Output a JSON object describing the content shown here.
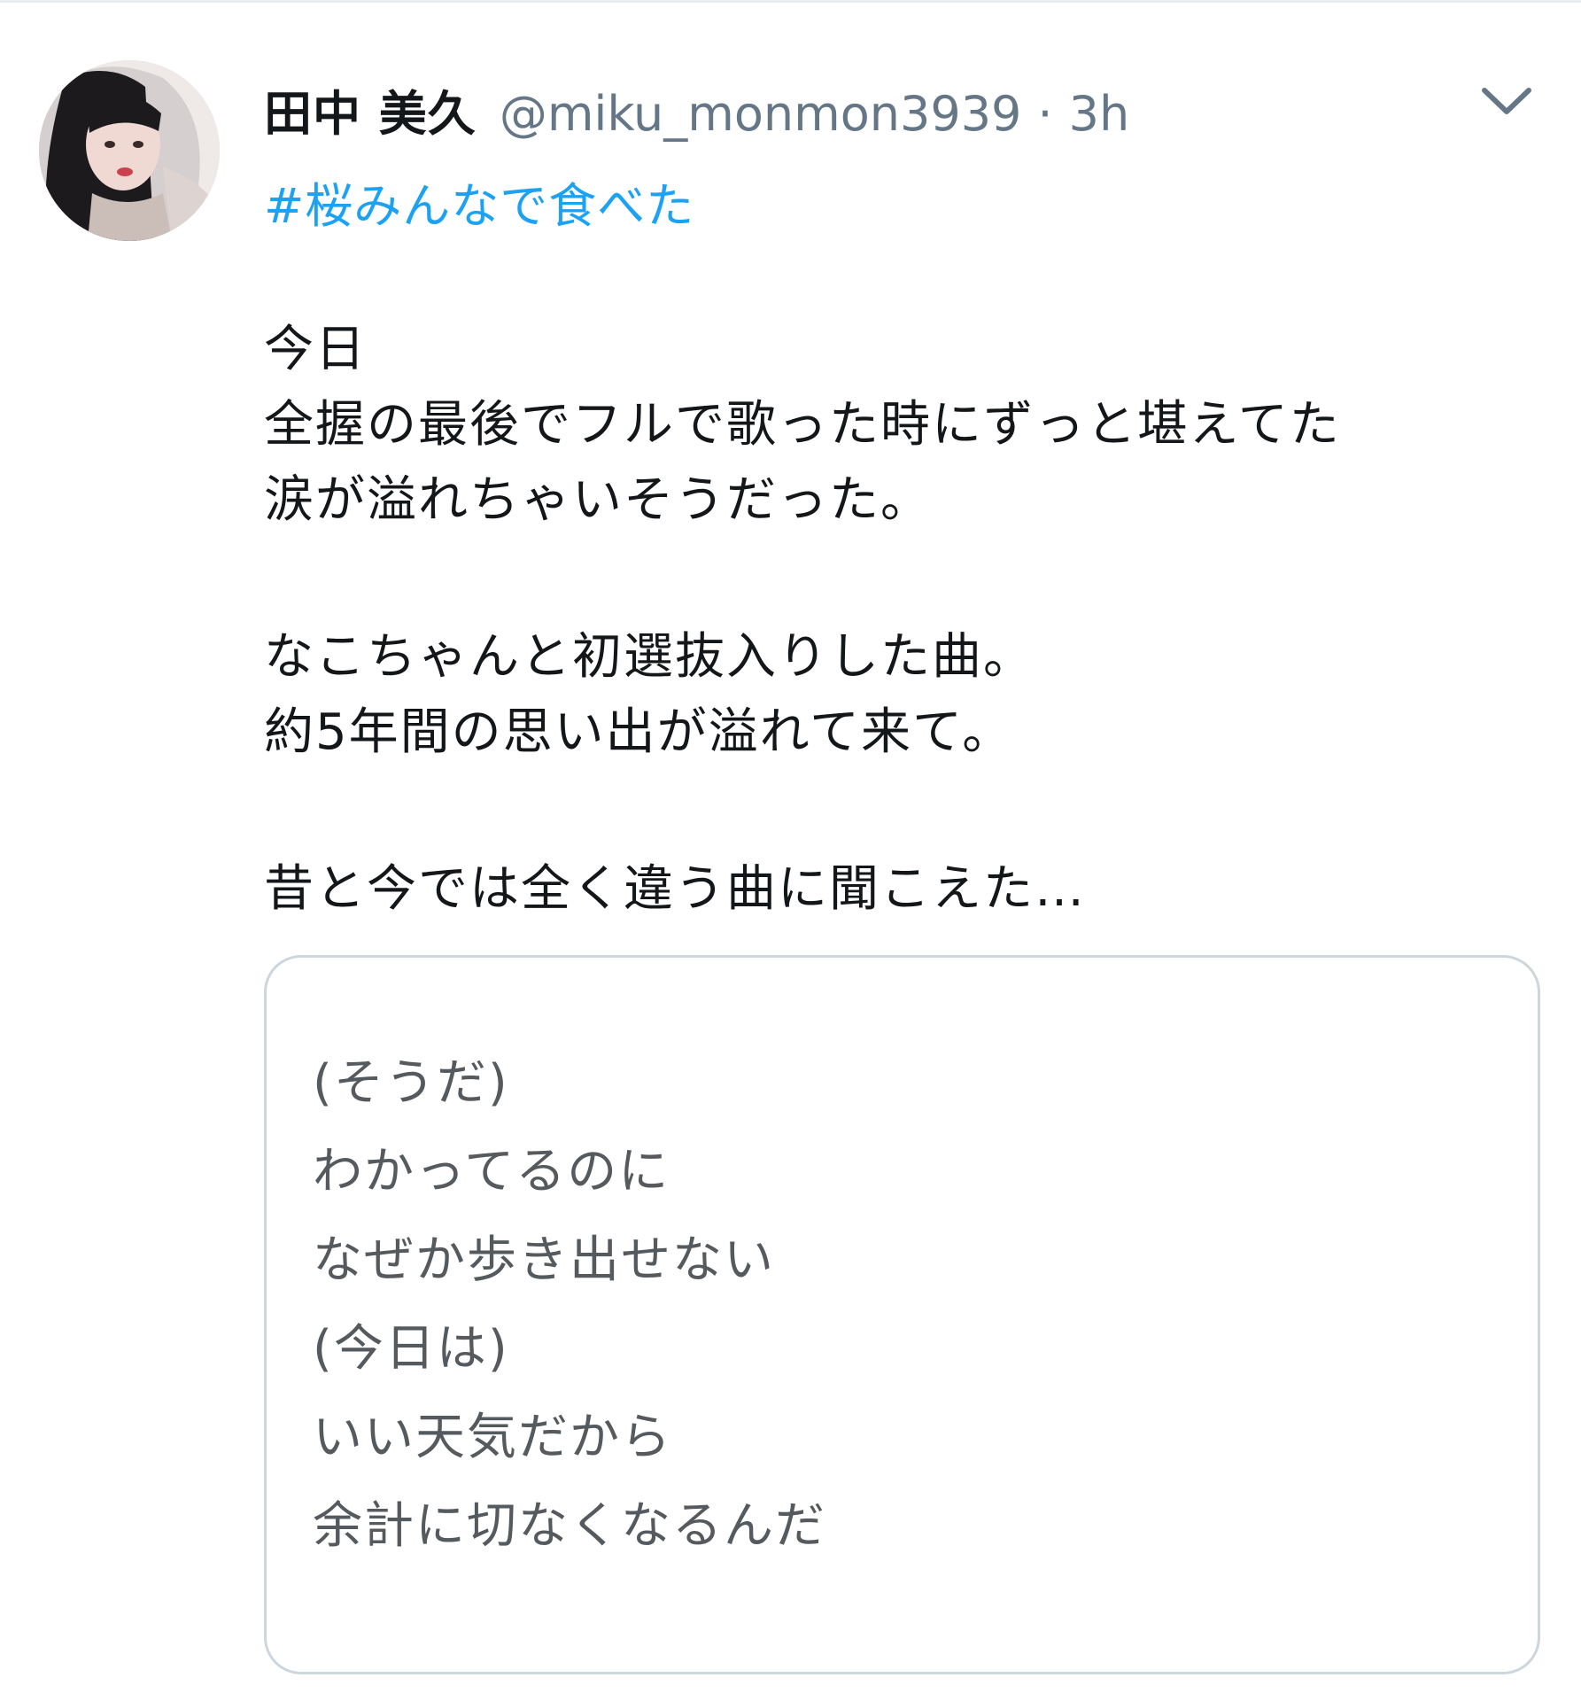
{
  "tweet": {
    "display_name": "田中 美久",
    "handle": "@miku_monmon3939",
    "separator": "·",
    "time": "3h",
    "hashtag": "#桜みんなで食べた",
    "paragraphs": [
      [
        "今日",
        "全握の最後でフルで歌った時にずっと堪えてた",
        "涙が溢れちゃいそうだった。"
      ],
      [
        "なこちゃんと初選抜入りした曲。",
        "約5年間の思い出が溢れて来て。"
      ],
      [
        "昔と今では全く違う曲に聞こえた…"
      ]
    ],
    "attached_image_lines": [
      "(そうだ)",
      "わかってるのに",
      "なぜか歩き出せない",
      "(今日は)",
      "いい天気だから",
      "余計に切なくなるんだ"
    ]
  },
  "icons": {
    "more_menu": "chevron-down-icon",
    "avatar": "user-avatar"
  },
  "colors": {
    "hashtag": "#1da1f2",
    "secondary_text": "#657786",
    "primary_text": "#14171a",
    "card_border": "#ccd6dd"
  }
}
